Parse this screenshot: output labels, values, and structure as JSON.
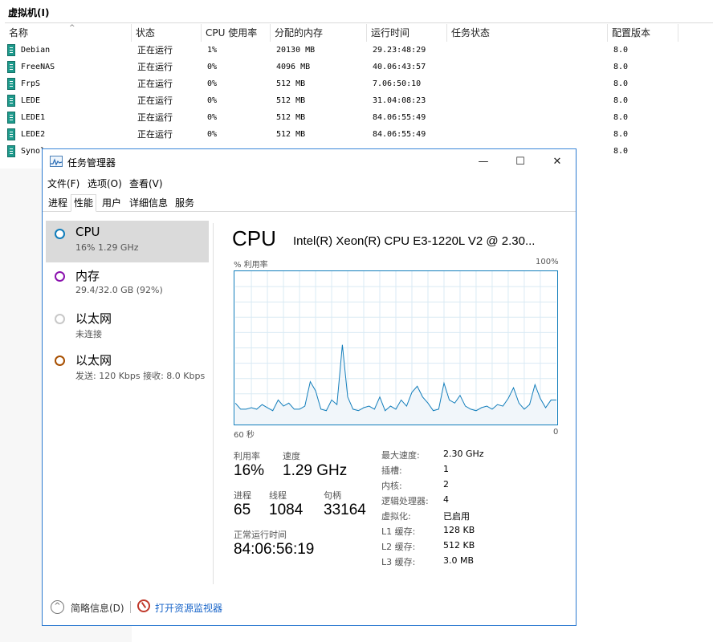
{
  "hyperv": {
    "title": "虚拟机(I)",
    "columns": [
      "名称",
      "状态",
      "CPU 使用率",
      "分配的内存",
      "运行时间",
      "任务状态",
      "配置版本"
    ],
    "vms": [
      {
        "name": "Debian",
        "state": "正在运行",
        "cpu": "1%",
        "mem": "20130 MB",
        "uptime": "29.23:48:29",
        "task": "",
        "version": "8.0"
      },
      {
        "name": "FreeNAS",
        "state": "正在运行",
        "cpu": "0%",
        "mem": "4096 MB",
        "uptime": "40.06:43:57",
        "task": "",
        "version": "8.0"
      },
      {
        "name": "FrpS",
        "state": "正在运行",
        "cpu": "0%",
        "mem": "512 MB",
        "uptime": "7.06:50:10",
        "task": "",
        "version": "8.0"
      },
      {
        "name": "LEDE",
        "state": "正在运行",
        "cpu": "0%",
        "mem": "512 MB",
        "uptime": "31.04:08:23",
        "task": "",
        "version": "8.0"
      },
      {
        "name": "LEDE1",
        "state": "正在运行",
        "cpu": "0%",
        "mem": "512 MB",
        "uptime": "84.06:55:49",
        "task": "",
        "version": "8.0"
      },
      {
        "name": "LEDE2",
        "state": "正在运行",
        "cpu": "0%",
        "mem": "512 MB",
        "uptime": "84.06:55:49",
        "task": "",
        "version": "8.0"
      },
      {
        "name": "Synol",
        "state": "",
        "cpu": "",
        "mem": "",
        "uptime": "",
        "task": "",
        "version": "8.0"
      }
    ]
  },
  "taskmgr": {
    "title": "任务管理器",
    "controls": {
      "minimize": "—",
      "maximize": "☐",
      "close": "✕"
    },
    "menu": [
      "文件(F)",
      "选项(O)",
      "查看(V)"
    ],
    "tabs": [
      "进程",
      "性能",
      "用户",
      "详细信息",
      "服务"
    ],
    "active_tab": "性能",
    "devices": [
      {
        "name": "CPU",
        "sub": "16% 1.29 GHz",
        "ring_color": "#117dbb",
        "selected": true
      },
      {
        "name": "内存",
        "sub": "29.4/32.0 GB (92%)",
        "ring_color": "#8b12ae",
        "selected": false
      },
      {
        "name": "以太网",
        "sub": "未连接",
        "ring_color": "#c8c8c8",
        "selected": false
      },
      {
        "name": "以太网",
        "sub": "发送: 120 Kbps 接收: 8.0 Kbps",
        "ring_color": "#a74f01",
        "selected": false
      }
    ],
    "cpu": {
      "heading": "CPU",
      "model": "Intel(R) Xeon(R) CPU E3-1220L V2 @ 2.30...",
      "graph_label_left": "% 利用率",
      "graph_label_right": "100%",
      "axis_left": "60 秒",
      "axis_right": "0",
      "util_label": "利用率",
      "util_value": "16%",
      "speed_label": "速度",
      "speed_value": "1.29 GHz",
      "proc_label": "进程",
      "proc_value": "65",
      "thread_label": "线程",
      "thread_value": "1084",
      "handle_label": "句柄",
      "handle_value": "33164",
      "uptime_label": "正常运行时间",
      "uptime_value": "84:06:56:19",
      "specs": [
        {
          "label": "最大速度:",
          "value": "2.30 GHz"
        },
        {
          "label": "插槽:",
          "value": "1"
        },
        {
          "label": "内核:",
          "value": "2"
        },
        {
          "label": "逻辑处理器:",
          "value": "4"
        },
        {
          "label": "虚拟化:",
          "value": "已启用"
        },
        {
          "label": "L1 缓存:",
          "value": "128 KB"
        },
        {
          "label": "L2 缓存:",
          "value": "512 KB"
        },
        {
          "label": "L3 缓存:",
          "value": "3.0 MB"
        }
      ]
    },
    "footer": {
      "fewer_details": "简略信息(D)",
      "resource_monitor": "打开资源监视器"
    },
    "colors": {
      "accent": "#117dbb",
      "graph_fill": "#f1f6fa",
      "graph_grid": "#d9eaf4"
    }
  },
  "chart_data": {
    "type": "area",
    "title": "",
    "xlabel": "",
    "ylabel": "% 利用率",
    "xlim": [
      60,
      0
    ],
    "ylim": [
      0,
      100
    ],
    "x": [
      60,
      59,
      58,
      57,
      56,
      55,
      54,
      53,
      52,
      51,
      50,
      49,
      48,
      47,
      46,
      45,
      44,
      43,
      42,
      41,
      40,
      39,
      38,
      37,
      36,
      35,
      34,
      33,
      32,
      31,
      30,
      29,
      28,
      27,
      26,
      25,
      24,
      23,
      22,
      21,
      20,
      19,
      18,
      17,
      16,
      15,
      14,
      13,
      12,
      11,
      10,
      9,
      8,
      7,
      6,
      5,
      4,
      3,
      2,
      1,
      0
    ],
    "series": [
      {
        "values": [
          14,
          10,
          10,
          11,
          10,
          13,
          11,
          9,
          16,
          12,
          14,
          10,
          10,
          12,
          28,
          22,
          10,
          9,
          16,
          13,
          52,
          18,
          10,
          9,
          11,
          12,
          10,
          18,
          9,
          12,
          10,
          16,
          12,
          21,
          25,
          18,
          14,
          9,
          10,
          27,
          16,
          14,
          19,
          12,
          10,
          9,
          11,
          12,
          10,
          13,
          12,
          17,
          24,
          14,
          10,
          13,
          26,
          17,
          11,
          16,
          16
        ]
      }
    ]
  }
}
